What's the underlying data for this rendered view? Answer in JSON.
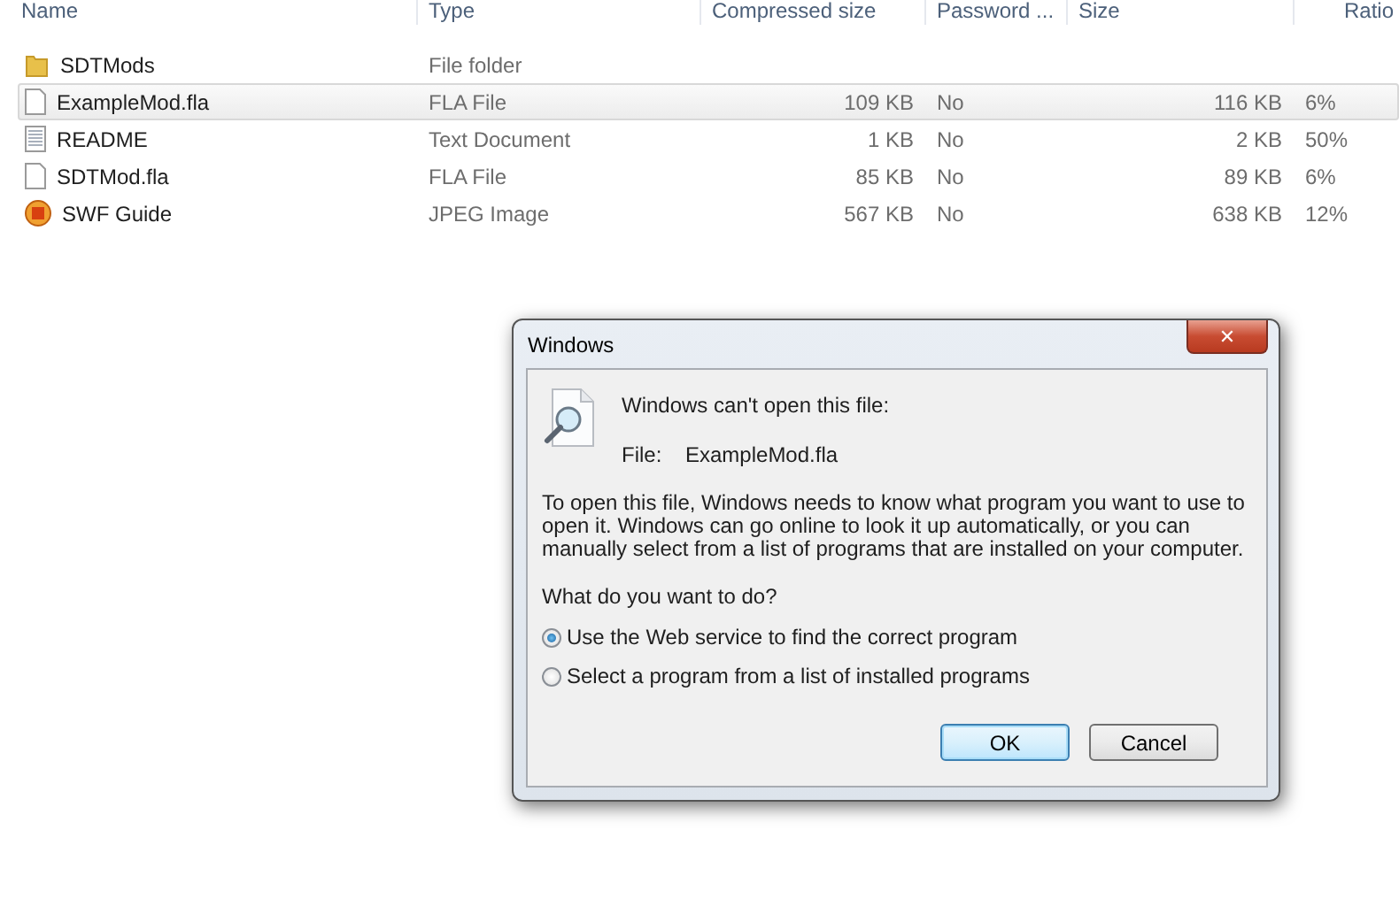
{
  "columns": [
    "Name",
    "Type",
    "Compressed size",
    "Password ...",
    "Size",
    "Ratio"
  ],
  "files": [
    {
      "kind": "folder",
      "name": "SDTMods",
      "type": "File folder",
      "selected": false
    },
    {
      "kind": "file",
      "name": "ExampleMod.fla",
      "type": "FLA File",
      "compressed": "109 KB",
      "password": "No",
      "size": "116 KB",
      "ratio": "6%",
      "selected": true
    },
    {
      "kind": "text",
      "name": "README",
      "type": "Text Document",
      "compressed": "1 KB",
      "password": "No",
      "size": "2 KB",
      "ratio": "50%",
      "selected": false
    },
    {
      "kind": "file",
      "name": "SDTMod.fla",
      "type": "FLA File",
      "compressed": "85 KB",
      "password": "No",
      "size": "89 KB",
      "ratio": "6%",
      "selected": false
    },
    {
      "kind": "image",
      "name": "SWF Guide",
      "type": "JPEG Image",
      "compressed": "567 KB",
      "password": "No",
      "size": "638 KB",
      "ratio": "12%",
      "selected": false
    }
  ],
  "dialog": {
    "title": "Windows",
    "close": "✕",
    "heading": "Windows can't open this file:",
    "file_label": "File:",
    "file_name": "ExampleMod.fla",
    "message": "To open this file, Windows needs to know what program you want to use to open it. Windows can go online to look it up automatically, or you can manually select from a list of programs that are installed on your computer.",
    "question": "What do you want to do?",
    "options": [
      {
        "label": "Use the Web service to find the correct program",
        "selected": true
      },
      {
        "label": "Select a program from a list of installed programs",
        "selected": false
      }
    ],
    "buttons": [
      {
        "label": "OK",
        "default": true
      },
      {
        "label": "Cancel",
        "default": false
      }
    ]
  }
}
